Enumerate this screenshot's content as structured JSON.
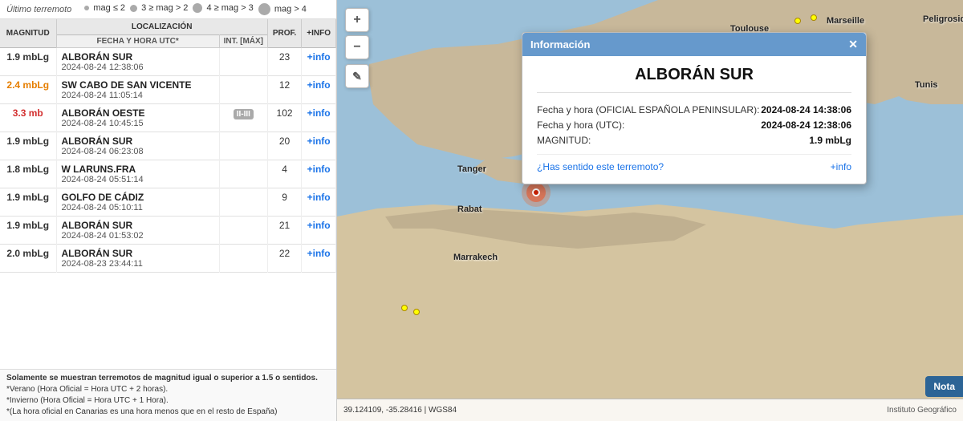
{
  "header": {
    "ultimo_terremoto": "Último terremoto",
    "legend": [
      {
        "label": "mag ≤ 2",
        "size": "s"
      },
      {
        "label": "3 ≥ mag > 2",
        "size": "m"
      },
      {
        "label": "4 ≥ mag > 3",
        "size": "l"
      },
      {
        "label": "mag > 4",
        "size": "xl"
      }
    ]
  },
  "table": {
    "col_magnitud": "MAGNITUD",
    "col_localizacion": "LOCALIZACIÓN",
    "col_fecha": "Fecha y Hora UTC*",
    "col_int": "Int. [máx]",
    "col_prof": "PROF.",
    "col_info": "+INFO",
    "rows": [
      {
        "magnitude": "1.9 mbLg",
        "mag_class": "mag-dark",
        "location": "ALBORÁN SUR",
        "datetime": "2024-08-24 12:38:06",
        "intensity": "",
        "prof": "23",
        "info": "+info"
      },
      {
        "magnitude": "2.4 mbLg",
        "mag_class": "mag-orange",
        "location": "SW CABO DE SAN VICENTE",
        "datetime": "2024-08-24 11:05:14",
        "intensity": "",
        "prof": "12",
        "info": "+info"
      },
      {
        "magnitude": "3.3 mb",
        "mag_class": "mag-red",
        "location": "ALBORÁN OESTE",
        "datetime": "2024-08-24 10:45:15",
        "intensity": "II-III",
        "prof": "102",
        "info": "+info"
      },
      {
        "magnitude": "1.9 mbLg",
        "mag_class": "mag-dark",
        "location": "ALBORÁN SUR",
        "datetime": "2024-08-24 06:23:08",
        "intensity": "",
        "prof": "20",
        "info": "+info"
      },
      {
        "magnitude": "1.8 mbLg",
        "mag_class": "mag-dark",
        "location": "W LARUNS.FRA",
        "datetime": "2024-08-24 05:51:14",
        "intensity": "",
        "prof": "4",
        "info": "+info"
      },
      {
        "magnitude": "1.9 mbLg",
        "mag_class": "mag-dark",
        "location": "GOLFO DE CÁDIZ",
        "datetime": "2024-08-24 05:10:11",
        "intensity": "",
        "prof": "9",
        "info": "+info"
      },
      {
        "magnitude": "1.9 mbLg",
        "mag_class": "mag-dark",
        "location": "ALBORÁN SUR",
        "datetime": "2024-08-24 01:53:02",
        "intensity": "",
        "prof": "21",
        "info": "+info"
      },
      {
        "magnitude": "2.0 mbLg",
        "mag_class": "mag-dark",
        "location": "ALBORÁN SUR",
        "datetime": "2024-08-23 23:44:11",
        "intensity": "",
        "prof": "22",
        "info": "+info"
      }
    ]
  },
  "footer": {
    "line1": "Solamente se muestran terremotos de magnitud igual o superior a 1.5 o sentidos.",
    "line2": "*Verano (Hora Oficial = Hora UTC + 2 horas).",
    "line3": "*Invierno (Hora Oficial = Hora UTC + 1 Hora).",
    "line4": "*(La hora oficial en Canarias es una hora menos que en el resto de España)"
  },
  "popup": {
    "header": "Información",
    "close": "✕",
    "title": "ALBORÁN SUR",
    "fecha_oficial_label": "Fecha y hora (OFICIAL ESPAÑOLA PENINSULAR):",
    "fecha_oficial_value": "2024-08-24 14:38:06",
    "fecha_utc_label": "Fecha y hora (UTC):",
    "fecha_utc_value": "2024-08-24 12:38:06",
    "magnitud_label": "MAGNITUD:",
    "magnitud_value": "1.9 mbLg",
    "sentido_link": "¿Has sentido este terremoto?",
    "info_link": "+info"
  },
  "map": {
    "coords": "39.124109, -35.28416 | WGS84",
    "attribution": "Instituto Geográfico"
  },
  "controls": {
    "zoom_in": "+",
    "zoom_out": "−",
    "edit_icon": "✎"
  },
  "nota_button": "Nota"
}
